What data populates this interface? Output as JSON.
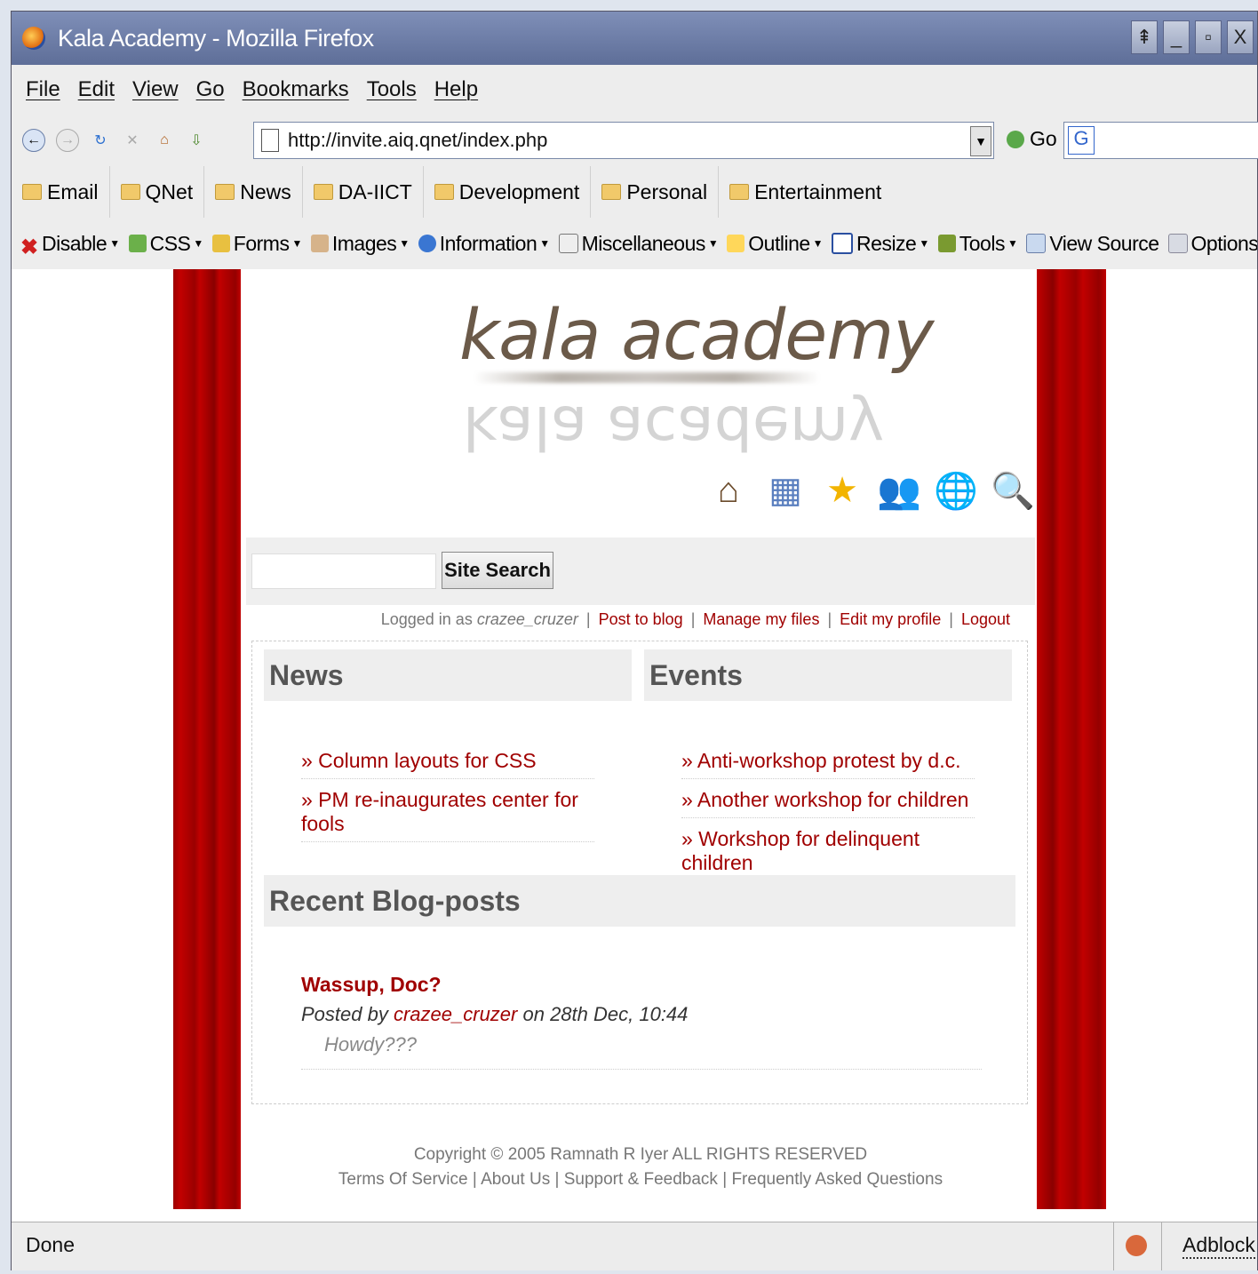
{
  "window": {
    "title": "Kala Academy - Mozilla Firefox"
  },
  "menu": [
    "File",
    "Edit",
    "View",
    "Go",
    "Bookmarks",
    "Tools",
    "Help"
  ],
  "nav": {
    "url": "http://invite.aiq.qnet/index.php",
    "go_label": "Go",
    "search_letter": "G"
  },
  "bookmarks": [
    "Email",
    "QNet",
    "News",
    "DA-IICT",
    "Development",
    "Personal",
    "Entertainment"
  ],
  "devtools": [
    "Disable",
    "CSS",
    "Forms",
    "Images",
    "Information",
    "Miscellaneous",
    "Outline",
    "Resize",
    "Tools",
    "View Source",
    "Options"
  ],
  "page": {
    "logo": "kala academy",
    "search_button": "Site Search",
    "user": {
      "prefix": "Logged in as",
      "name": "crazee_cruzer",
      "links": [
        "Post to blog",
        "Manage my files",
        "Edit my profile",
        "Logout"
      ]
    },
    "news": {
      "title": "News",
      "items": [
        "» Column layouts for CSS",
        "» PM re-inaugurates center for fools"
      ]
    },
    "events": {
      "title": "Events",
      "items": [
        "» Anti-workshop protest by d.c.",
        "» Another workshop for children",
        "» Workshop for delinquent children"
      ]
    },
    "blog": {
      "title": "Recent Blog-posts",
      "post_title": "Wassup, Doc?",
      "posted_by": "Posted by",
      "author": "crazee_cruzer",
      "date": "on 28th Dec, 10:44",
      "body": "Howdy???"
    },
    "footer": {
      "copyright": "Copyright © 2005 Ramnath R Iyer ALL RIGHTS RESERVED",
      "links": [
        "Terms Of Service",
        "About Us",
        "Support & Feedback",
        "Frequently Asked Questions"
      ]
    }
  },
  "status": {
    "text": "Done",
    "adblock": "Adblock"
  },
  "colors": {
    "accent": "#a00000",
    "curtain": "#c10000"
  }
}
